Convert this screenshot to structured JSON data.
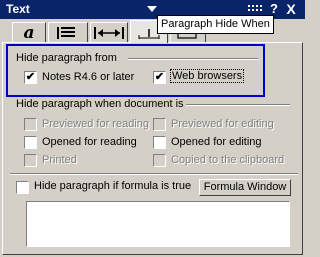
{
  "window": {
    "title": "Text",
    "help_label": "?",
    "close_label": "X",
    "tooltip": "Paragraph Hide When"
  },
  "tabs": [
    {
      "name": "font",
      "label": "a"
    },
    {
      "name": "paragraph-alignment",
      "icon": "alignment-icon"
    },
    {
      "name": "paragraph-margins",
      "icon": "margins-icon"
    },
    {
      "name": "paragraph-hide-when",
      "icon": "hide-when-icon"
    },
    {
      "name": "paragraph-styles",
      "icon": "styles-icon"
    }
  ],
  "hide_from": {
    "heading": "Hide paragraph from",
    "options": [
      {
        "label": "Notes R4.6 or later",
        "checked": true
      },
      {
        "label": "Web browsers",
        "checked": true
      }
    ]
  },
  "hide_when": {
    "heading": "Hide paragraph when document is",
    "options": [
      {
        "label": "Previewed for reading",
        "checked": false,
        "enabled": false
      },
      {
        "label": "Previewed for editing",
        "checked": false,
        "enabled": false
      },
      {
        "label": "Opened for reading",
        "checked": false,
        "enabled": true
      },
      {
        "label": "Opened for editing",
        "checked": false,
        "enabled": true
      },
      {
        "label": "Printed",
        "checked": false,
        "enabled": false
      },
      {
        "label": "Copied to the clipboard",
        "checked": false,
        "enabled": false
      }
    ]
  },
  "formula": {
    "checkbox_label": "Hide paragraph if formula is true",
    "checked": false,
    "button_label": "Formula Window",
    "value": ""
  },
  "colors": {
    "titlebar": "#0a246a",
    "highlight": "#0000c8",
    "face": "#d4d0c8"
  }
}
